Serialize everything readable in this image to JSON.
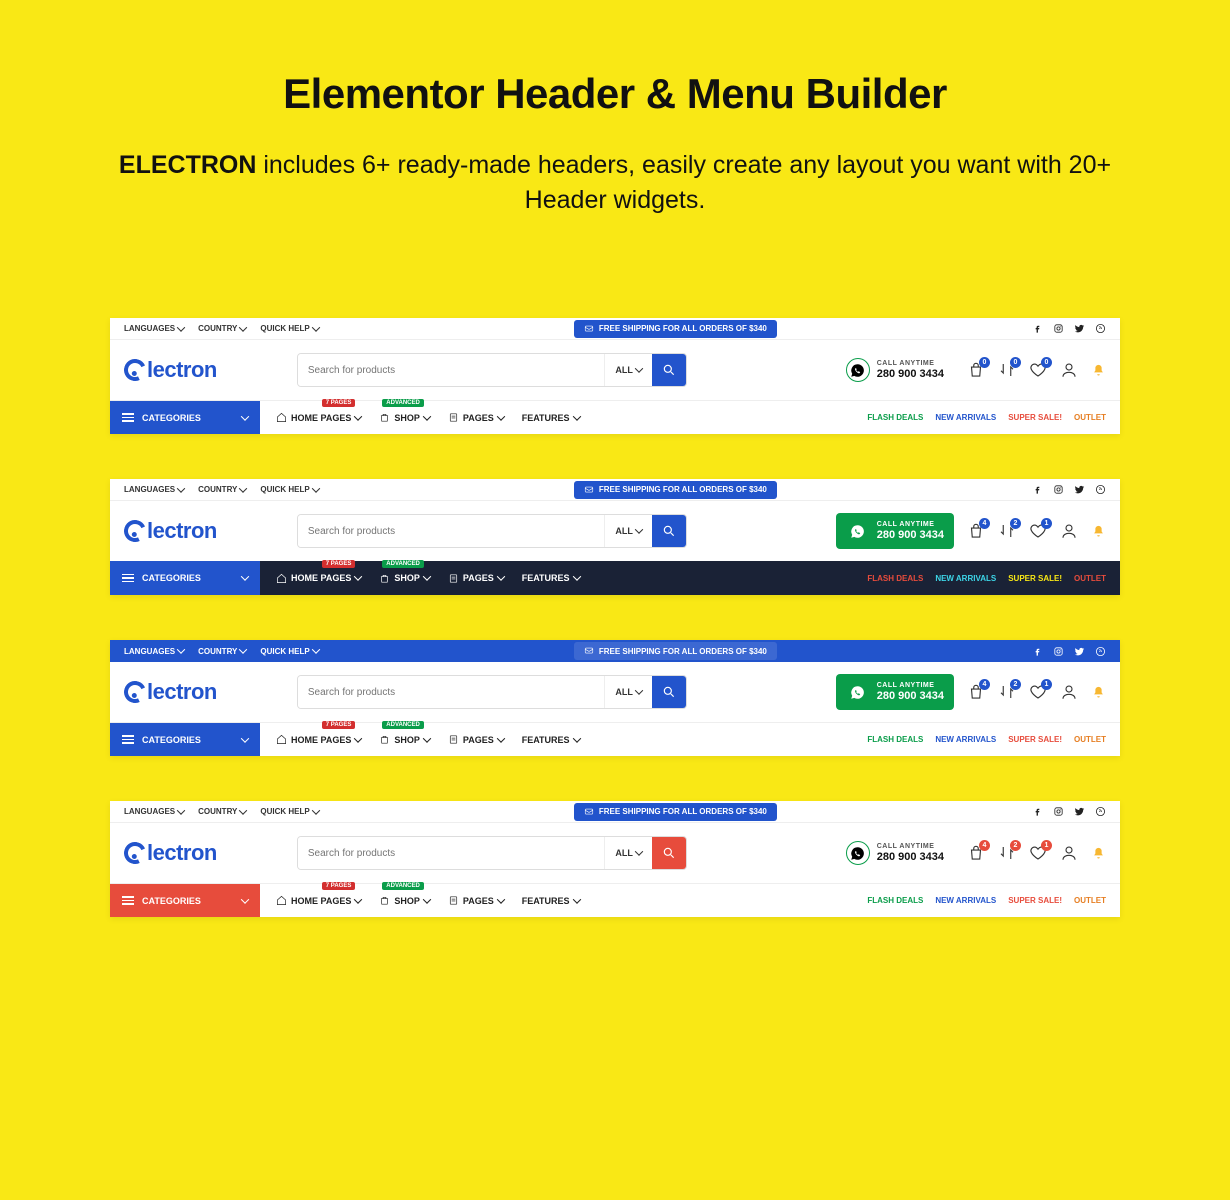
{
  "heading": "Elementor Header & Menu Builder",
  "sub_bold": "ELECTRON",
  "sub_rest": " includes 6+ ready-made headers, easily create any layout you want with 20+ Header widgets.",
  "brand": "lectron",
  "top": {
    "lang": "LANGUAGES",
    "country": "COUNTRY",
    "help": "QUICK HELP"
  },
  "shipping": "FREE SHIPPING FOR ALL ORDERS OF $340",
  "search": {
    "placeholder": "Search for products",
    "all": "ALL"
  },
  "call": {
    "label": "CALL ANYTIME",
    "num": "280 900 3434"
  },
  "cat": "CATEGORIES",
  "nav": {
    "home": "HOME PAGES",
    "shop": "SHOP",
    "pages": "PAGES",
    "features": "FEATURES"
  },
  "tags": {
    "pages": "7 PAGES",
    "advanced": "ADVANCED"
  },
  "links": {
    "flash": "FLASH DEALS",
    "new": "NEW ARRIVALS",
    "super": "SUPER SALE!",
    "outlet": "OUTLET"
  },
  "badge0": "0",
  "badge1": "1",
  "badge2": "2",
  "badge4": "4",
  "variants": [
    {
      "topbar": "",
      "call": "plain",
      "searchBtn": "blue",
      "catBtn": "blue",
      "navbar": "",
      "badge": "blue",
      "badges": [
        "0",
        "0",
        "0"
      ],
      "linkColors": [
        "green",
        "blue",
        "red",
        "orange"
      ]
    },
    {
      "topbar": "",
      "call": "green",
      "searchBtn": "blue",
      "catBtn": "blue",
      "navbar": "dark",
      "badge": "blue",
      "badges": [
        "4",
        "2",
        "1"
      ],
      "linkColors": [
        "red",
        "cyan",
        "yellow",
        "red"
      ]
    },
    {
      "topbar": "blue",
      "call": "green",
      "searchBtn": "blue",
      "catBtn": "blue",
      "navbar": "",
      "badge": "blue",
      "badges": [
        "4",
        "2",
        "1"
      ],
      "linkColors": [
        "green",
        "blue",
        "red",
        "orange"
      ]
    },
    {
      "topbar": "",
      "call": "plain",
      "searchBtn": "red",
      "catBtn": "red",
      "navbar": "",
      "badge": "red",
      "badges": [
        "4",
        "2",
        "1"
      ],
      "linkColors": [
        "green",
        "blue",
        "red",
        "orange"
      ]
    }
  ]
}
